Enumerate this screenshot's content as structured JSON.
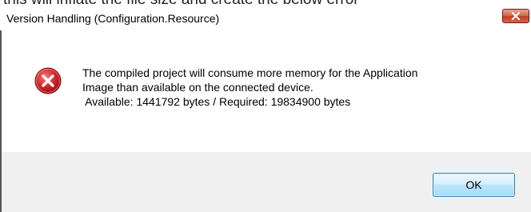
{
  "background": {
    "partial_text": "this will inflate the file size and create the below error"
  },
  "dialog": {
    "title": "Version Handling (Configuration.Resource)",
    "close_icon": "close-icon",
    "error_icon": "error-icon",
    "message_lines": [
      "The compiled project will consume more memory for the Application",
      "Image than available on the connected device.",
      " Available: 1441792 bytes / Required: 19834900 bytes"
    ],
    "ok_label": "OK"
  },
  "colors": {
    "close_button": "#c74a32",
    "error_icon": "#c8102e",
    "ok_border": "#3c7fb1"
  }
}
